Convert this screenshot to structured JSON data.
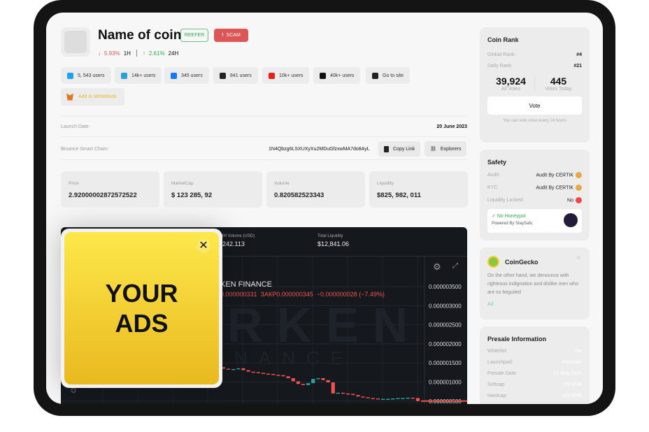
{
  "coin": {
    "name": "Name of coin",
    "reefer": "REEFER",
    "scam": "SCAM",
    "change_1h": "5.93%",
    "label_1h": "1H",
    "change_24h": "2.61%",
    "label_24h": "24H"
  },
  "socials": [
    {
      "icon": "twitter-icon",
      "label": "5, 543 users",
      "color": "#1da1f2"
    },
    {
      "icon": "telegram-icon",
      "label": "14k+ users",
      "color": "#2a9fd8"
    },
    {
      "icon": "facebook-icon",
      "label": "345 users",
      "color": "#1877f2"
    },
    {
      "icon": "discord-icon",
      "label": "841 users",
      "color": "#222"
    },
    {
      "icon": "youtube-icon",
      "label": "10k+ users",
      "color": "#e62117"
    },
    {
      "icon": "tiktok-icon",
      "label": "40k+ users",
      "color": "#111"
    },
    {
      "icon": "globe-icon",
      "label": "Go to site",
      "color": "#222"
    }
  ],
  "metamask": "Add to MetaMask",
  "info": {
    "launch_label": "Launch Date:",
    "launch_value": "20 June 2023",
    "chain_label": "Binance Smart Chain:",
    "address": "1N4Qbzg6LSXUXyXu2MDuGfzxwMA7do8AyL",
    "copy": "Copy Link",
    "explorers": "Explorers"
  },
  "stats": [
    {
      "label": "Price",
      "value": "2.92000002872572522"
    },
    {
      "label": "MarketCap",
      "value": "$ 123 285, 92"
    },
    {
      "label": "Volume",
      "value": "0.820582523343"
    },
    {
      "label": "Liquidity",
      "value": "$825, 982, 011"
    }
  ],
  "chart": {
    "vol_label": "24H Volume (USD)",
    "vol_value": "$242.113",
    "liq_label": "Total Liquidity",
    "liq_value": "$12,841.06",
    "symbol": "KEN FINANCE",
    "ohlc": "0.000000331  ЗАКР0.000000345  −0.000000028 (−7.49%)",
    "watermark1": "RKEN",
    "watermark2": "NANCE",
    "yticks": [
      "0.000003500",
      "0.000003000",
      "0.000002500",
      "0.000002000",
      "0.000001500",
      "0.000001000",
      "0.000000500"
    ],
    "up_color": "#26a69a",
    "down_color": "#ef5350"
  },
  "chart_data": {
    "type": "candlestick",
    "ylim": [
      5e-07,
      3.5e-06
    ],
    "close": [
      1.45,
      1.42,
      1.4,
      1.38,
      1.36,
      1.37,
      1.39,
      1.35,
      1.33,
      1.34,
      1.36,
      1.31,
      1.27,
      1.26,
      1.24,
      1.22,
      1.21,
      1.19,
      1.18,
      1.15,
      1.1,
      1.02,
      0.95,
      0.92,
      0.97,
      1.08,
      1.1,
      1.05,
      0.99,
      0.7,
      0.72,
      0.7,
      0.69,
      0.66,
      0.62,
      0.6,
      0.58,
      0.57,
      0.56,
      0.56,
      0.56,
      0.57,
      0.58,
      0.58,
      0.59,
      0.58,
      0.5
    ]
  },
  "ad": {
    "line1": "YOUR",
    "line2": "ADS"
  },
  "rank": {
    "title": "Coin Rank",
    "global_label": "Global Rank:",
    "global": "#4",
    "daily_label": "Daily Rank:",
    "daily": "#21",
    "all_votes": "39,924",
    "all_label": "All Votes",
    "today_votes": "445",
    "today_label": "Votes Today",
    "vote": "Vote",
    "note": "You can vote once every 24 hours"
  },
  "safety": {
    "title": "Safety",
    "audit_label": "Audit:",
    "audit": "Audit By CERTIK",
    "kyc_label": "KYC:",
    "kyc": "Audit By CERTIK",
    "liq_label": "Liquidity Locked:",
    "liq": "No",
    "honeypot": "No Honeypot",
    "powered": "Powered By StaySafu"
  },
  "gecko": {
    "title": "CoinGecko",
    "text": "On the other hand, we denounce with righteous indignation and dislike men who are so beguiled",
    "ad": "Ad"
  },
  "presale": {
    "title": "Presale Information",
    "rows": [
      {
        "k": "Whitelist:",
        "v": "Yes"
      },
      {
        "k": "Launchpad:",
        "v": "PinkSale"
      },
      {
        "k": "Presale Date:",
        "v": "05 May 2023"
      },
      {
        "k": "Softcap:",
        "v": "100 BNB"
      },
      {
        "k": "Hardcap:",
        "v": "500 BNB"
      }
    ]
  }
}
